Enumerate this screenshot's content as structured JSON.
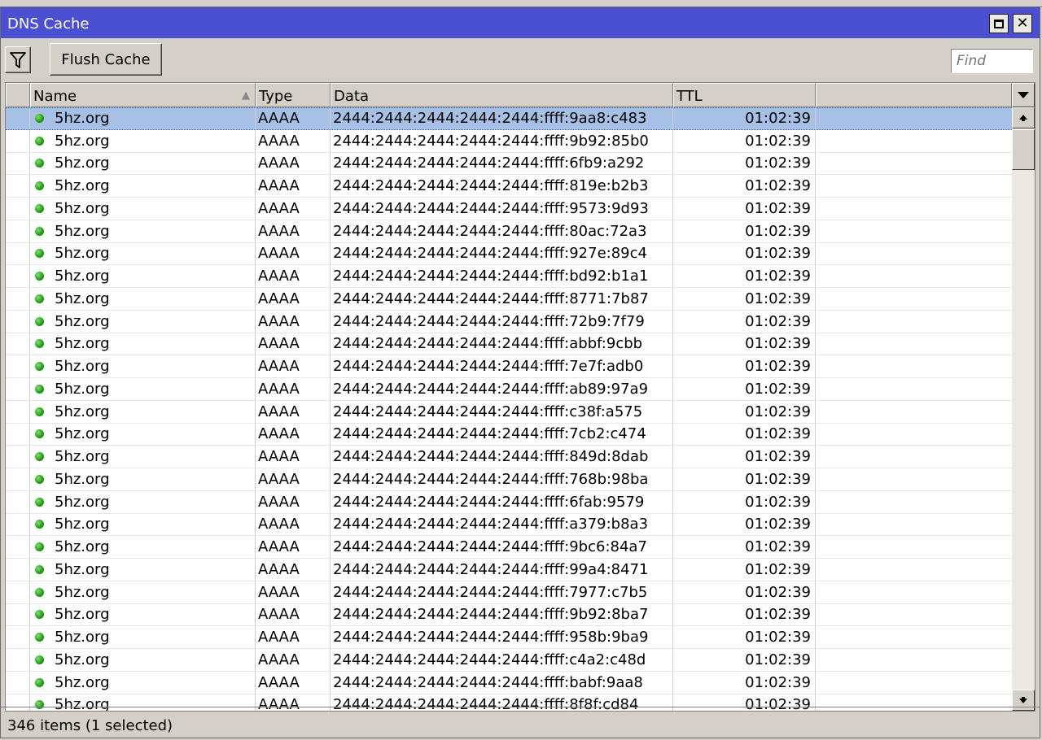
{
  "window": {
    "title": "DNS Cache"
  },
  "toolbar": {
    "flush_label": "Flush Cache",
    "find_placeholder": "Find"
  },
  "table": {
    "columns": [
      {
        "label": "Name",
        "sorted": "ascending"
      },
      {
        "label": "Type"
      },
      {
        "label": "Data"
      },
      {
        "label": "TTL"
      }
    ],
    "rows": [
      {
        "name": "5hz.org",
        "type": "AAAA",
        "data": "2444:2444:2444:2444:2444:ffff:9aa8:c483",
        "ttl": "01:02:39",
        "selected": true
      },
      {
        "name": "5hz.org",
        "type": "AAAA",
        "data": "2444:2444:2444:2444:2444:ffff:9b92:85b0",
        "ttl": "01:02:39"
      },
      {
        "name": "5hz.org",
        "type": "AAAA",
        "data": "2444:2444:2444:2444:2444:ffff:6fb9:a292",
        "ttl": "01:02:39"
      },
      {
        "name": "5hz.org",
        "type": "AAAA",
        "data": "2444:2444:2444:2444:2444:ffff:819e:b2b3",
        "ttl": "01:02:39"
      },
      {
        "name": "5hz.org",
        "type": "AAAA",
        "data": "2444:2444:2444:2444:2444:ffff:9573:9d93",
        "ttl": "01:02:39"
      },
      {
        "name": "5hz.org",
        "type": "AAAA",
        "data": "2444:2444:2444:2444:2444:ffff:80ac:72a3",
        "ttl": "01:02:39"
      },
      {
        "name": "5hz.org",
        "type": "AAAA",
        "data": "2444:2444:2444:2444:2444:ffff:927e:89c4",
        "ttl": "01:02:39"
      },
      {
        "name": "5hz.org",
        "type": "AAAA",
        "data": "2444:2444:2444:2444:2444:ffff:bd92:b1a1",
        "ttl": "01:02:39"
      },
      {
        "name": "5hz.org",
        "type": "AAAA",
        "data": "2444:2444:2444:2444:2444:ffff:8771:7b87",
        "ttl": "01:02:39"
      },
      {
        "name": "5hz.org",
        "type": "AAAA",
        "data": "2444:2444:2444:2444:2444:ffff:72b9:7f79",
        "ttl": "01:02:39"
      },
      {
        "name": "5hz.org",
        "type": "AAAA",
        "data": "2444:2444:2444:2444:2444:ffff:abbf:9cbb",
        "ttl": "01:02:39"
      },
      {
        "name": "5hz.org",
        "type": "AAAA",
        "data": "2444:2444:2444:2444:2444:ffff:7e7f:adb0",
        "ttl": "01:02:39"
      },
      {
        "name": "5hz.org",
        "type": "AAAA",
        "data": "2444:2444:2444:2444:2444:ffff:ab89:97a9",
        "ttl": "01:02:39"
      },
      {
        "name": "5hz.org",
        "type": "AAAA",
        "data": "2444:2444:2444:2444:2444:ffff:c38f:a575",
        "ttl": "01:02:39"
      },
      {
        "name": "5hz.org",
        "type": "AAAA",
        "data": "2444:2444:2444:2444:2444:ffff:7cb2:c474",
        "ttl": "01:02:39"
      },
      {
        "name": "5hz.org",
        "type": "AAAA",
        "data": "2444:2444:2444:2444:2444:ffff:849d:8dab",
        "ttl": "01:02:39"
      },
      {
        "name": "5hz.org",
        "type": "AAAA",
        "data": "2444:2444:2444:2444:2444:ffff:768b:98ba",
        "ttl": "01:02:39"
      },
      {
        "name": "5hz.org",
        "type": "AAAA",
        "data": "2444:2444:2444:2444:2444:ffff:6fab:9579",
        "ttl": "01:02:39"
      },
      {
        "name": "5hz.org",
        "type": "AAAA",
        "data": "2444:2444:2444:2444:2444:ffff:a379:b8a3",
        "ttl": "01:02:39"
      },
      {
        "name": "5hz.org",
        "type": "AAAA",
        "data": "2444:2444:2444:2444:2444:ffff:9bc6:84a7",
        "ttl": "01:02:39"
      },
      {
        "name": "5hz.org",
        "type": "AAAA",
        "data": "2444:2444:2444:2444:2444:ffff:99a4:8471",
        "ttl": "01:02:39"
      },
      {
        "name": "5hz.org",
        "type": "AAAA",
        "data": "2444:2444:2444:2444:2444:ffff:7977:c7b5",
        "ttl": "01:02:39"
      },
      {
        "name": "5hz.org",
        "type": "AAAA",
        "data": "2444:2444:2444:2444:2444:ffff:9b92:8ba7",
        "ttl": "01:02:39"
      },
      {
        "name": "5hz.org",
        "type": "AAAA",
        "data": "2444:2444:2444:2444:2444:ffff:958b:9ba9",
        "ttl": "01:02:39"
      },
      {
        "name": "5hz.org",
        "type": "AAAA",
        "data": "2444:2444:2444:2444:2444:ffff:c4a2:c48d",
        "ttl": "01:02:39"
      },
      {
        "name": "5hz.org",
        "type": "AAAA",
        "data": "2444:2444:2444:2444:2444:ffff:babf:9aa8",
        "ttl": "01:02:39"
      },
      {
        "name": "5hz.org",
        "type": "AAAA",
        "data": "2444:2444:2444:2444:2444:ffff:8f8f:cd84",
        "ttl": "01:02:39"
      }
    ]
  },
  "status": {
    "text": "346 items (1 selected)"
  },
  "colors": {
    "titlebar": "#4b4fd2",
    "selected_row": "#a6c0e6",
    "status_dot": "#1f9a15"
  },
  "icons": {
    "filter": "filter-icon",
    "maximize": "maximize-icon",
    "close": "close-icon",
    "status": "status-dot-icon"
  }
}
